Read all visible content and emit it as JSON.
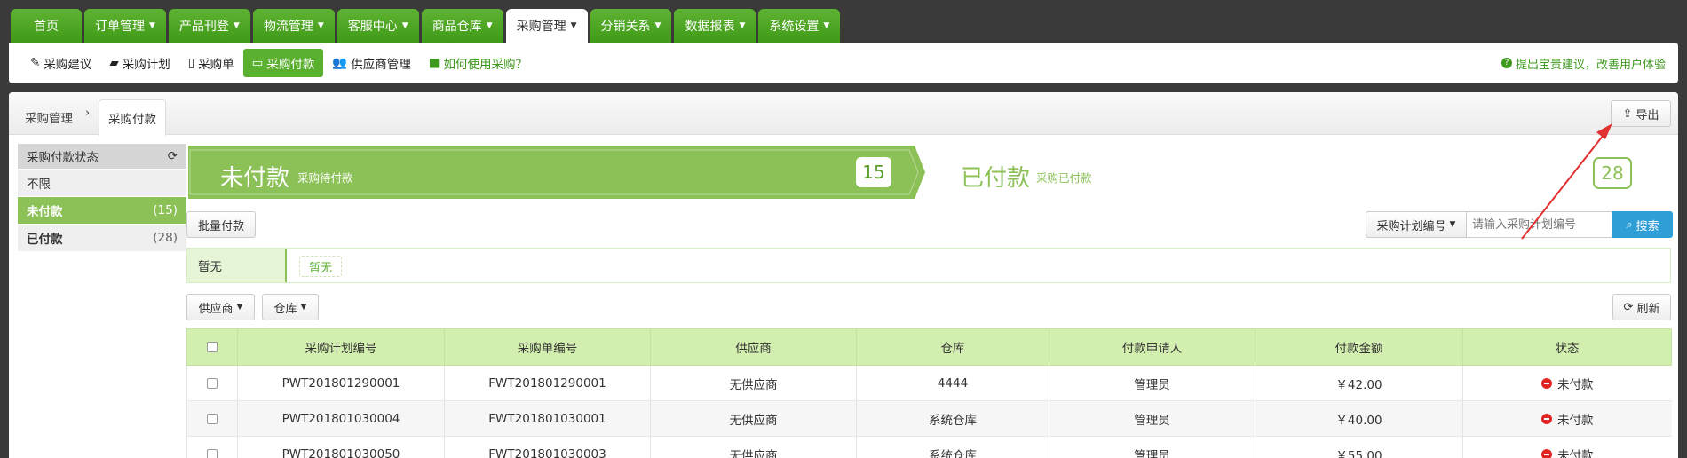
{
  "topnav": [
    {
      "label": "首页",
      "caret": false,
      "active": false
    },
    {
      "label": "订单管理",
      "caret": true,
      "active": false
    },
    {
      "label": "产品刊登",
      "caret": true,
      "active": false
    },
    {
      "label": "物流管理",
      "caret": true,
      "active": false
    },
    {
      "label": "客服中心",
      "caret": true,
      "active": false
    },
    {
      "label": "商品仓库",
      "caret": true,
      "active": false
    },
    {
      "label": "采购管理",
      "caret": true,
      "active": true
    },
    {
      "label": "分销关系",
      "caret": true,
      "active": false
    },
    {
      "label": "数据报表",
      "caret": true,
      "active": false
    },
    {
      "label": "系统设置",
      "caret": true,
      "active": false
    }
  ],
  "subnav": {
    "items": [
      {
        "label": "采购建议",
        "icon": "pencil-icon"
      },
      {
        "label": "采购计划",
        "icon": "book-icon"
      },
      {
        "label": "采购单",
        "icon": "file-icon"
      },
      {
        "label": "采购付款",
        "icon": "credit-card-icon"
      },
      {
        "label": "供应商管理",
        "icon": "users-icon"
      },
      {
        "label": "如何使用采购？",
        "icon": "video-icon"
      }
    ],
    "feedback": "提出宝贵建议，改善用户体验"
  },
  "breadcrumb": {
    "parent": "采购管理",
    "current": "采购付款"
  },
  "export_label": "导出",
  "sidebar": {
    "title": "采购付款状态",
    "rows": [
      {
        "label": "不限",
        "count": ""
      },
      {
        "label": "未付款",
        "count": "(15)"
      },
      {
        "label": "已付款",
        "count": "(28)"
      }
    ]
  },
  "unpaid": {
    "title": "未付款",
    "subtitle": "采购待付款",
    "count": "15"
  },
  "paid": {
    "title": "已付款",
    "subtitle": "采购已付款",
    "count": "28"
  },
  "batch_pay_label": "批量付款",
  "search": {
    "field": "采购计划编号",
    "placeholder": "请输入采购计划编号",
    "button": "搜索"
  },
  "filter": {
    "label": "暂无",
    "tag": "暂无"
  },
  "buttons": {
    "supplier": "供应商",
    "warehouse": "仓库",
    "refresh": "刷新"
  },
  "table": {
    "headers": [
      "采购计划编号",
      "采购单编号",
      "供应商",
      "仓库",
      "付款申请人",
      "付款金额",
      "状态"
    ],
    "rows": [
      [
        "PWT201801290001",
        "FWT201801290001",
        "无供应商",
        "4444",
        "管理员",
        "￥42.00",
        "未付款"
      ],
      [
        "PWT201801030004",
        "FWT201801030001",
        "无供应商",
        "系统仓库",
        "管理员",
        "￥40.00",
        "未付款"
      ],
      [
        "PWT201801030050",
        "FWT201801030003",
        "无供应商",
        "系统仓库",
        "管理员",
        "￥55.00",
        "未付款"
      ]
    ]
  },
  "colors": {
    "green": "#5ab02f",
    "light_green": "#8cc158",
    "blue": "#2e9ed6",
    "red": "#e02424"
  }
}
